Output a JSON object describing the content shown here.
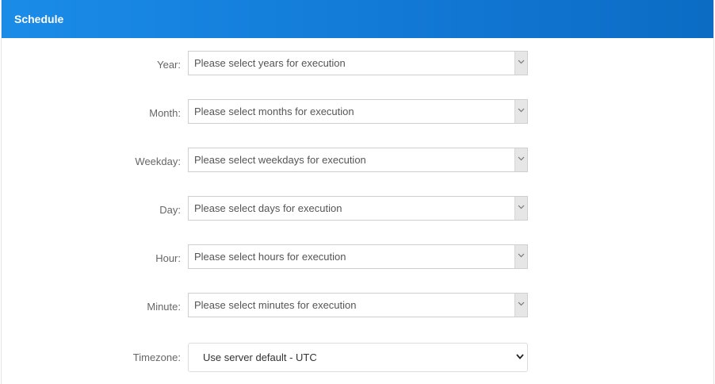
{
  "header": {
    "title": "Schedule"
  },
  "fields": [
    {
      "label": "Year:",
      "placeholder": "Please select years for execution"
    },
    {
      "label": "Month:",
      "placeholder": "Please select months for execution"
    },
    {
      "label": "Weekday:",
      "placeholder": "Please select weekdays for execution"
    },
    {
      "label": "Day:",
      "placeholder": "Please select days for execution"
    },
    {
      "label": "Hour:",
      "placeholder": "Please select hours for execution"
    },
    {
      "label": "Minute:",
      "placeholder": "Please select minutes for execution"
    }
  ],
  "timezone": {
    "label": "Timezone:",
    "value": "Use server default - UTC"
  },
  "icons": {
    "dropdown": "chevron-down-icon"
  }
}
